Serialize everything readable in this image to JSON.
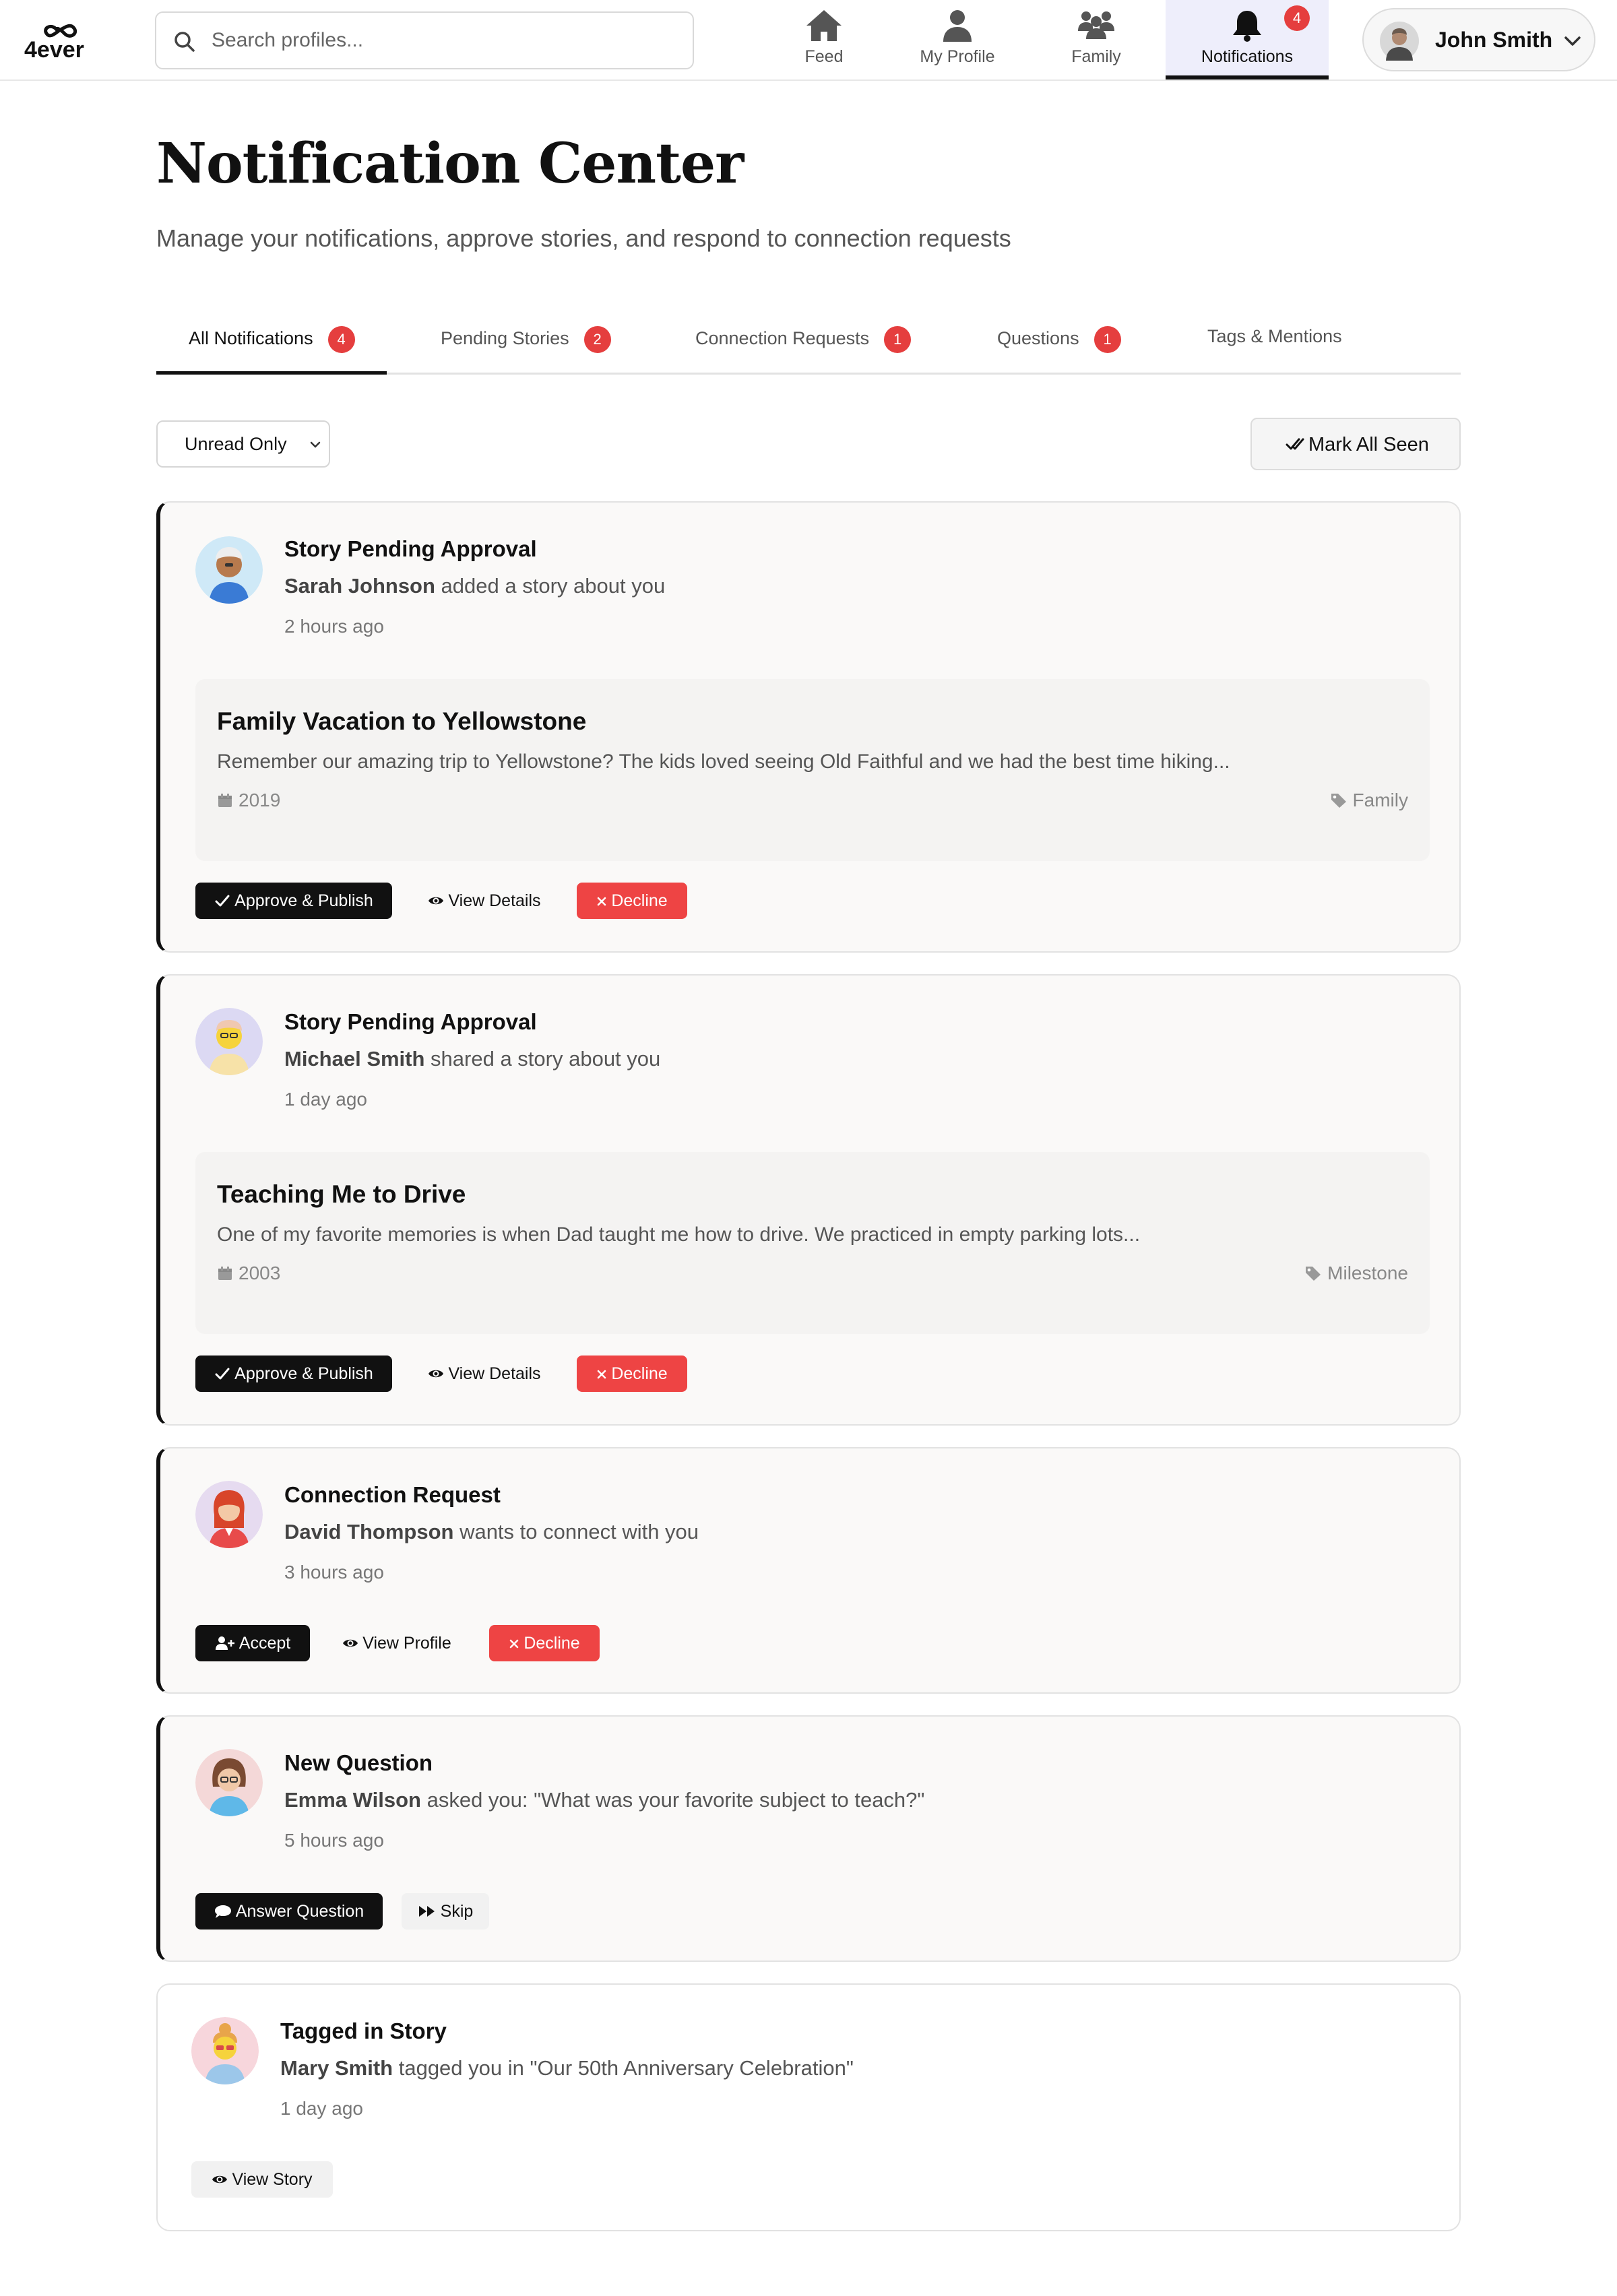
{
  "app": {
    "logo_text": "4ever"
  },
  "search": {
    "placeholder": "Search profiles..."
  },
  "nav": {
    "items": [
      {
        "label": "Feed",
        "icon": "home-icon"
      },
      {
        "label": "My Profile",
        "icon": "user-icon"
      },
      {
        "label": "Family",
        "icon": "users-icon"
      },
      {
        "label": "Notifications",
        "icon": "bell-icon",
        "badge": "4",
        "active": true
      }
    ]
  },
  "user": {
    "name": "John Smith"
  },
  "page": {
    "title": "Notification Center",
    "subtitle": "Manage your notifications, approve stories, and respond to connection requests"
  },
  "tabs": [
    {
      "label": "All Notifications",
      "badge": "4",
      "active": true
    },
    {
      "label": "Pending Stories",
      "badge": "2"
    },
    {
      "label": "Connection Requests",
      "badge": "1"
    },
    {
      "label": "Questions",
      "badge": "1"
    },
    {
      "label": "Tags & Mentions"
    }
  ],
  "filters": {
    "select_value": "Unread Only",
    "mark_all_label": "Mark All Seen"
  },
  "notifications": [
    {
      "type": "Story Pending Approval",
      "actor": "Sarah Johnson",
      "message": " added a story about you",
      "time": "2 hours ago",
      "story": {
        "title": "Family Vacation to Yellowstone",
        "excerpt": "Remember our amazing trip to Yellowstone? The kids loved seeing Old Faithful and we had the best time hiking...",
        "year": "2019",
        "tag": "Family"
      },
      "actions": [
        "Approve & Publish",
        "View Details",
        "Decline"
      ]
    },
    {
      "type": "Story Pending Approval",
      "actor": "Michael Smith",
      "message": " shared a story about you",
      "time": "1 day ago",
      "story": {
        "title": "Teaching Me to Drive",
        "excerpt": "One of my favorite memories is when Dad taught me how to drive. We practiced in empty parking lots...",
        "year": "2003",
        "tag": "Milestone"
      },
      "actions": [
        "Approve & Publish",
        "View Details",
        "Decline"
      ]
    },
    {
      "type": "Connection Request",
      "actor": "David Thompson",
      "message": " wants to connect with you",
      "time": "3 hours ago",
      "actions": [
        "Accept",
        "View Profile",
        "Decline"
      ]
    },
    {
      "type": "New Question",
      "actor": "Emma Wilson",
      "message": " asked you: \"What was your favorite subject to teach?\"",
      "time": "5 hours ago",
      "actions": [
        "Answer Question",
        "Skip"
      ]
    },
    {
      "type": "Tagged in Story",
      "actor": "Mary Smith",
      "message": " tagged you in \"Our 50th Anniversary Celebration\"",
      "time": "1 day ago",
      "actions": [
        "View Story"
      ]
    }
  ],
  "colors": {
    "accent": "#111111",
    "badge": "#e53e3e",
    "danger": "#ee4444",
    "active_nav_bg": "#eeeefb"
  }
}
